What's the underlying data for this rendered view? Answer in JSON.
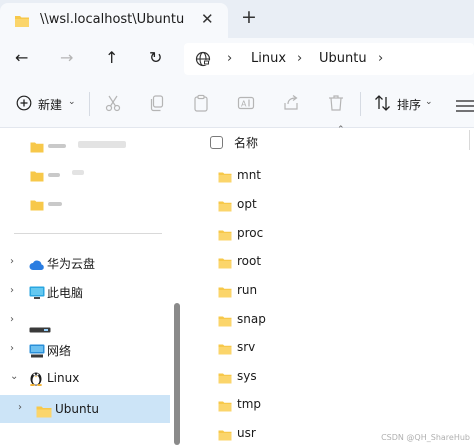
{
  "tab": {
    "title": "\\\\wsl.localhost\\Ubuntu",
    "close": "✕",
    "new": "+"
  },
  "nav": {
    "back": "←",
    "forward": "→",
    "up": "↑",
    "refresh": "↻",
    "breadcrumbs": [
      "Linux",
      "Ubuntu"
    ]
  },
  "toolbar": {
    "new_label": "新建",
    "sort_label": "排序"
  },
  "sidebar": {
    "items": [
      {
        "label": "华为云盘",
        "icon": "cloud-icon"
      },
      {
        "label": "此电脑",
        "icon": "monitor-icon"
      },
      {
        "label": "",
        "icon": "drive-icon"
      },
      {
        "label": "网络",
        "icon": "network-icon"
      },
      {
        "label": "Linux",
        "icon": "penguin-icon"
      },
      {
        "label": "Ubuntu",
        "icon": "folder-icon"
      }
    ]
  },
  "content": {
    "column_name": "名称",
    "files": [
      "mnt",
      "opt",
      "proc",
      "root",
      "run",
      "snap",
      "srv",
      "sys",
      "tmp",
      "usr"
    ]
  },
  "watermark": "CSDN @QH_ShareHub",
  "colors": {
    "accent": "#0067c0",
    "folder": "#f7c84a",
    "selected": "#cce4f7"
  }
}
